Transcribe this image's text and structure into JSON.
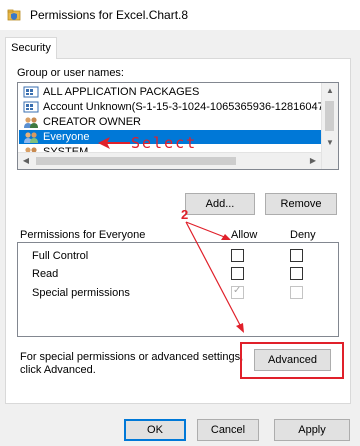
{
  "window": {
    "title": "Permissions for Excel.Chart.8"
  },
  "tabs": [
    {
      "label": "Security"
    }
  ],
  "group_section": {
    "label": "Group or user names:",
    "items": [
      {
        "label": "ALL APPLICATION PACKAGES",
        "icon": "app-packages-icon",
        "selected": false
      },
      {
        "label": "Account Unknown(S-1-15-3-1024-1065365936-128160471",
        "icon": "unknown-account-icon",
        "selected": false
      },
      {
        "label": "CREATOR OWNER",
        "icon": "users-icon",
        "selected": false
      },
      {
        "label": "Everyone",
        "icon": "users-icon",
        "selected": true
      },
      {
        "label": "SYSTEM",
        "icon": "users-icon",
        "selected": false
      }
    ],
    "add_button": "Add...",
    "remove_button": "Remove"
  },
  "permissions_section": {
    "header": "Permissions for Everyone",
    "allow_header": "Allow",
    "deny_header": "Deny",
    "rows": [
      {
        "label": "Full Control",
        "allow": false,
        "deny": false,
        "disabled": false
      },
      {
        "label": "Read",
        "allow": false,
        "deny": false,
        "disabled": false
      },
      {
        "label": "Special permissions",
        "allow": true,
        "deny": false,
        "disabled": true
      }
    ]
  },
  "advanced_section": {
    "text_line1": "For special permissions or advanced settings,",
    "text_line2": "click Advanced.",
    "advanced_button": "Advanced"
  },
  "footer": {
    "ok_button": "OK",
    "cancel_button": "Cancel",
    "apply_button": "Apply"
  },
  "annotations": {
    "select_label": "Select",
    "step_number": "2",
    "color": "#e0202a"
  },
  "colors": {
    "selection": "#0078d7",
    "window_bg": "#f0f0f0"
  }
}
